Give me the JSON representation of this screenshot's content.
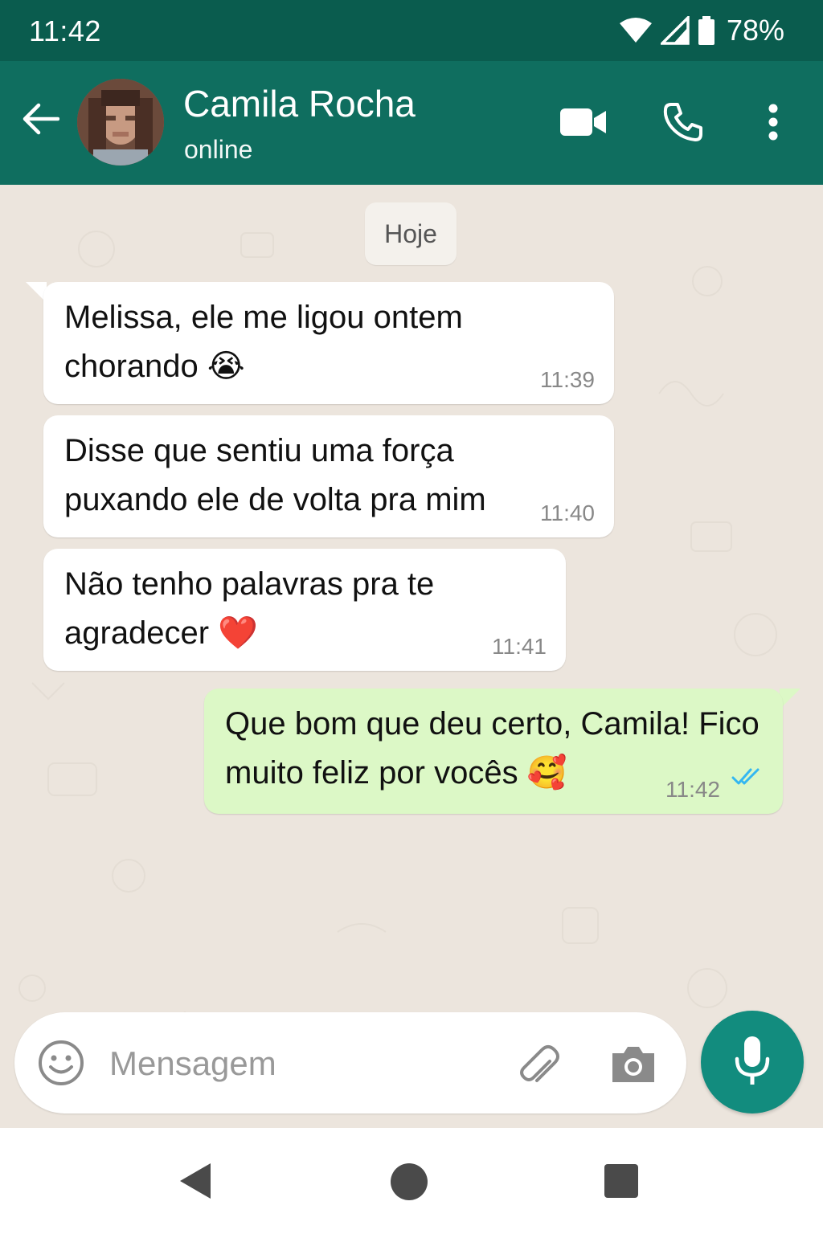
{
  "status_bar": {
    "time": "11:42",
    "battery": "78%",
    "icons": [
      "wifi-icon",
      "signal-icon",
      "battery-icon"
    ]
  },
  "header": {
    "contact_name": "Camila Rocha",
    "contact_status": "online",
    "icons": [
      "back-arrow-icon",
      "video-call-icon",
      "voice-call-icon",
      "more-options-icon"
    ]
  },
  "chat": {
    "date_separator": "Hoje",
    "messages": [
      {
        "direction": "incoming",
        "text": "Melissa, ele me ligou ontem\nchorando",
        "emoji": "😭",
        "time": "11:39"
      },
      {
        "direction": "incoming",
        "text": "Disse que sentiu uma força\npuxando ele de volta pra mim",
        "emoji": "",
        "time": "11:40"
      },
      {
        "direction": "incoming",
        "text": "Não tenho palavras pra te\nagradecer",
        "emoji": "❤️",
        "time": "11:41"
      },
      {
        "direction": "outgoing",
        "text": "Que bom que deu certo, Camila! Fico\nmuito feliz por vocês",
        "emoji": "🥰",
        "time": "11:42",
        "status": "read"
      }
    ]
  },
  "composer": {
    "placeholder": "Mensagem",
    "icons": [
      "emoji-icon",
      "attach-icon",
      "camera-icon",
      "microphone-icon"
    ]
  },
  "colors": {
    "status_bar": "#0a5c4e",
    "app_bar": "#0f6e5f",
    "chat_background": "#ece5dd",
    "outgoing_bubble": "#dcf8c6",
    "incoming_bubble": "#ffffff",
    "mic_button": "#128c7e",
    "read_ticks": "#34b7f1"
  }
}
